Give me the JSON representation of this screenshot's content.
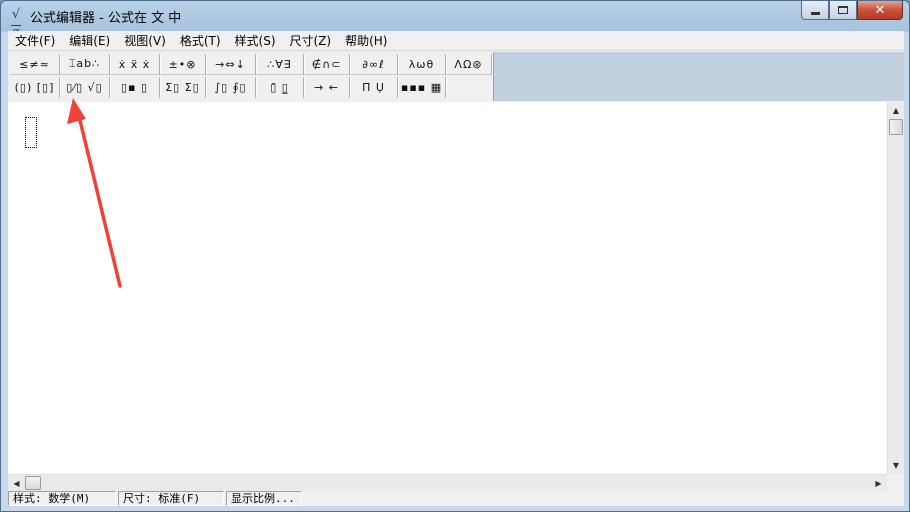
{
  "window": {
    "title": "公式编辑器 - 公式在 文 中",
    "app_icon_glyph": "α",
    "minimize_icon": "minimize-icon",
    "maximize_icon": "maximize-icon",
    "close_glyph": "✕"
  },
  "menubar": {
    "items": [
      {
        "label": "文件(F)"
      },
      {
        "label": "编辑(E)"
      },
      {
        "label": "视图(V)"
      },
      {
        "label": "格式(T)"
      },
      {
        "label": "样式(S)"
      },
      {
        "label": "尺寸(Z)"
      },
      {
        "label": "帮助(H)"
      }
    ]
  },
  "toolbar": {
    "row1": [
      {
        "name": "relational-symbols",
        "glyph": "≤≠≈"
      },
      {
        "name": "spaces-ellipses",
        "glyph": "⌶ab∴"
      },
      {
        "name": "embellishments",
        "glyph": "ẋ ẍ ẋ"
      },
      {
        "name": "operator-symbols",
        "glyph": "±•⊗"
      },
      {
        "name": "arrow-symbols",
        "glyph": "→⇔↓"
      },
      {
        "name": "logical-symbols",
        "glyph": "∴∀∃"
      },
      {
        "name": "set-theory-symbols",
        "glyph": "∉∩⊂"
      },
      {
        "name": "misc-symbols",
        "glyph": "∂∞ℓ"
      },
      {
        "name": "greek-lowercase",
        "glyph": "λωθ"
      },
      {
        "name": "greek-uppercase",
        "glyph": "ΛΩ⊛"
      }
    ],
    "row2": [
      {
        "name": "fence-templates",
        "glyph": "(▯) [▯]"
      },
      {
        "name": "fraction-radical-templates",
        "glyph": "▯⁄▯ √▯"
      },
      {
        "name": "subscript-superscript-templates",
        "glyph": "▯▪ ▯"
      },
      {
        "name": "summation-templates",
        "glyph": "Σ▯ Σ▯"
      },
      {
        "name": "integral-templates",
        "glyph": "∫▯ ∮▯"
      },
      {
        "name": "underbar-overbar-templates",
        "glyph": "▯̄ ▯̲"
      },
      {
        "name": "labeled-arrow-templates",
        "glyph": "→ ←"
      },
      {
        "name": "products-set-templates",
        "glyph": "Π̄ Ụ"
      },
      {
        "name": "matrix-templates",
        "glyph": "▪▪▪ ▦"
      }
    ]
  },
  "statusbar": {
    "style": "样式: 数学(M)",
    "size": "尺寸: 标准(F)",
    "zoom": "显示比例..."
  },
  "colors": {
    "annotation_arrow": "#f0413a",
    "toolbar_background": "#c1d0de"
  }
}
